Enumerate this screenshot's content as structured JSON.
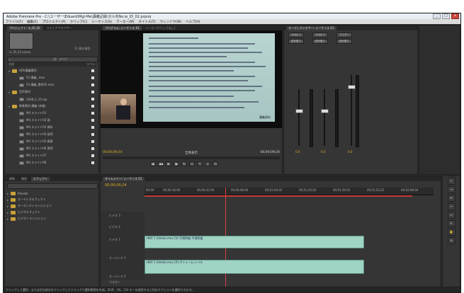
{
  "window": {
    "title": "Adobe Premiere Pro - C:\\ユーザー\\Eduard\\Mgl-Ma\\講義記録\\ガル内No.ie_ID_02.prproj"
  },
  "menu": [
    "ファイル(F)",
    "編集(E)",
    "プロジェクト(P)",
    "クリップ(C)",
    "シーケンス(S)",
    "マーカー(M)",
    "タイトル(T)",
    "ウィンドウ(W)",
    "ヘルプ(H)"
  ],
  "project": {
    "tabs": [
      "プロジェクト: ie_ID_02",
      "メディアブラウザー"
    ],
    "name": "ie_ID_02.prproj",
    "item_count": "11 個の項目",
    "search_label": "内:",
    "search_value": "すべて",
    "col_name": "名前",
    "col_label": "ラベル",
    "items": [
      {
        "label": "HDV講義素材",
        "kind": "folder",
        "expand": "▾"
      },
      {
        "label": "S3 講義_.mov",
        "kind": "clip",
        "expand": ""
      },
      {
        "label": "S3 講義_素材02.mov",
        "kind": "clip",
        "expand": ""
      },
      {
        "label": "音声素材",
        "kind": "folder",
        "expand": "▾"
      },
      {
        "label": "2008_5_15.mp",
        "kind": "clip",
        "expand": ""
      },
      {
        "label": "映像素材 講義 (非編)",
        "kind": "folder",
        "expand": "▾"
      },
      {
        "label": "M4 スライド01",
        "kind": "clip",
        "expand": ""
      },
      {
        "label": "M4 スライド02 図",
        "kind": "clip",
        "expand": ""
      },
      {
        "label": "M4 スライド03 資料",
        "kind": "clip",
        "expand": ""
      },
      {
        "label": "M4 スライド04 説明",
        "kind": "clip",
        "expand": ""
      },
      {
        "label": "M4 スライド05 概要",
        "kind": "clip",
        "expand": ""
      },
      {
        "label": "M4 スライド06 実例",
        "kind": "clip",
        "expand": ""
      },
      {
        "label": "M4 スライド07",
        "kind": "clip",
        "expand": ""
      },
      {
        "label": "M4 スライド08",
        "kind": "clip",
        "expand": ""
      }
    ]
  },
  "source": {
    "tab": "ソース: (クリップなし)",
    "tc_left": "00;00;00;00",
    "fit": "全体表示",
    "tc_right": "00;00;00;00"
  },
  "program": {
    "tab": "プログラム: シーケンス 01",
    "tc_left": "00;00;09;24",
    "fit": "全体表示",
    "tc_right": "00;00;09;24",
    "slide_caption": "講義資料"
  },
  "mixer": {
    "tab": "オーディオミキサー: シーケンス 01",
    "tracks": [
      {
        "name": "Audio 1",
        "mode": "読み取り",
        "value": "0.0"
      },
      {
        "name": "Audio 2",
        "mode": "読み取り",
        "value": "0.0"
      },
      {
        "name": "マスター",
        "mode": "読み取り",
        "value": "0.0"
      }
    ]
  },
  "effects": {
    "tabs": [
      "情報",
      "履歴",
      "エフェクト"
    ],
    "items": [
      "Presets",
      "オーディオエフェクト",
      "オーディオトランジション",
      "ビデオエフェクト",
      "ビデオトランジション"
    ]
  },
  "timeline": {
    "tab": "タイムライン: シーケンス 01",
    "timecode": "00;00;09;24",
    "ticks": [
      "00;00",
      "00;00;16;00",
      "00;00;32;00",
      "00;00;48;00",
      "00;01;04;02",
      "00;01;20;02",
      "00;01;36;02",
      "00;01;52;02",
      "00;02;08;04"
    ],
    "tracks": [
      {
        "name": "ビデオ 3"
      },
      {
        "name": "ビデオ 2"
      },
      {
        "name": "ビデオ 1",
        "clip": "HDV 1 (Ikeda).mov [V] 不透明度:不透明度"
      },
      {
        "name": "オーディオ 1",
        "clip": "HDV 1 (Ikeda).mov [A] ボリューム:レベル"
      },
      {
        "name": "オーディオ 2"
      },
      {
        "name": "マスター"
      }
    ]
  },
  "status": "クリックして選択、または空白部分をクリックしてドラッグで選択範囲を作成。Shift、Alt、Ctrl キーを使用すると別のオプションを選択できます。"
}
